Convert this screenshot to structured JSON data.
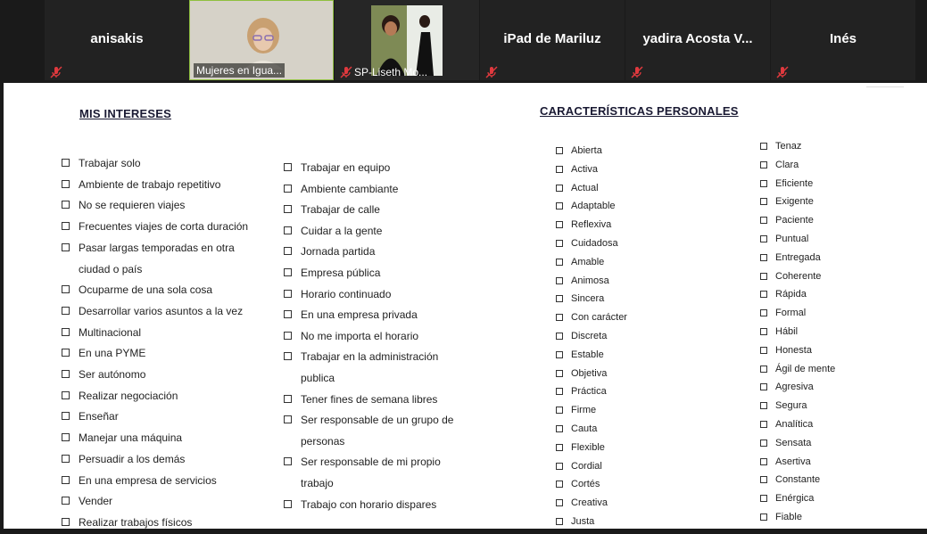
{
  "participants": [
    {
      "type": "name",
      "name": "anisakis",
      "muted": true
    },
    {
      "type": "video",
      "name": "Mujeres en Igua...",
      "muted": false
    },
    {
      "type": "video",
      "name": "SP-Liseth Mo...",
      "muted": true
    },
    {
      "type": "name",
      "name": "iPad de Mariluz",
      "muted": true
    },
    {
      "type": "name",
      "name": "yadira Acosta V...",
      "muted": true
    },
    {
      "type": "name",
      "name": "Inés",
      "muted": true
    }
  ],
  "document": {
    "interests_title": "MIS INTERESES",
    "traits_title": "CARACTERÍSTICAS PERSONALES",
    "interests_col1": [
      "Trabajar solo",
      "Ambiente de trabajo repetitivo",
      "No se requieren viajes",
      "Frecuentes viajes de corta duración",
      "Pasar largas temporadas en otra",
      "ciudad o país",
      "Ocuparme de una sola cosa",
      "Desarrollar varios asuntos a la vez",
      "Multinacional",
      "En una PYME",
      "Ser autónomo",
      "Realizar negociación",
      "Enseñar",
      "Manejar una máquina",
      "Persuadir a los demás",
      "En una empresa de servicios",
      "Vender",
      "Realizar trabajos físicos"
    ],
    "interests_col2": [
      "Trabajar en equipo",
      "Ambiente cambiante",
      "Trabajar de calle",
      "Cuidar a la gente",
      "Jornada partida",
      "Empresa pública",
      "Horario continuado",
      "En una empresa privada",
      "No me importa el horario",
      "Trabajar en la administración",
      "publica",
      "Tener fines de semana libres",
      "Ser responsable de un grupo de",
      "personas",
      "Ser responsable de mi propio",
      "trabajo",
      "Trabajo con horario dispares"
    ],
    "traits_col1": [
      "Abierta",
      "Activa",
      "Actual",
      "Adaptable",
      "Reflexiva",
      "Cuidadosa",
      "Amable",
      "Animosa",
      "Sincera",
      "Con carácter",
      "Discreta",
      "Estable",
      "Objetiva",
      "Práctica",
      "Firme",
      "Cauta",
      "Flexible",
      "Cordial",
      "Cortés",
      "Creativa",
      "Justa"
    ],
    "traits_col2": [
      "Tenaz",
      "Clara",
      "Eficiente",
      "Exigente",
      "Paciente",
      "Puntual",
      "Entregada",
      "Coherente",
      "Rápida",
      "Formal",
      "Hábil",
      "Honesta",
      "Ágil de mente",
      "Agresiva",
      "Segura",
      "Analítica",
      "Sensata",
      "Asertiva",
      "Constante",
      "Enérgica",
      "Fiable"
    ]
  },
  "colors": {
    "active_speaker_border": "#8fbf3f",
    "mute_icon": "#e0393e"
  }
}
